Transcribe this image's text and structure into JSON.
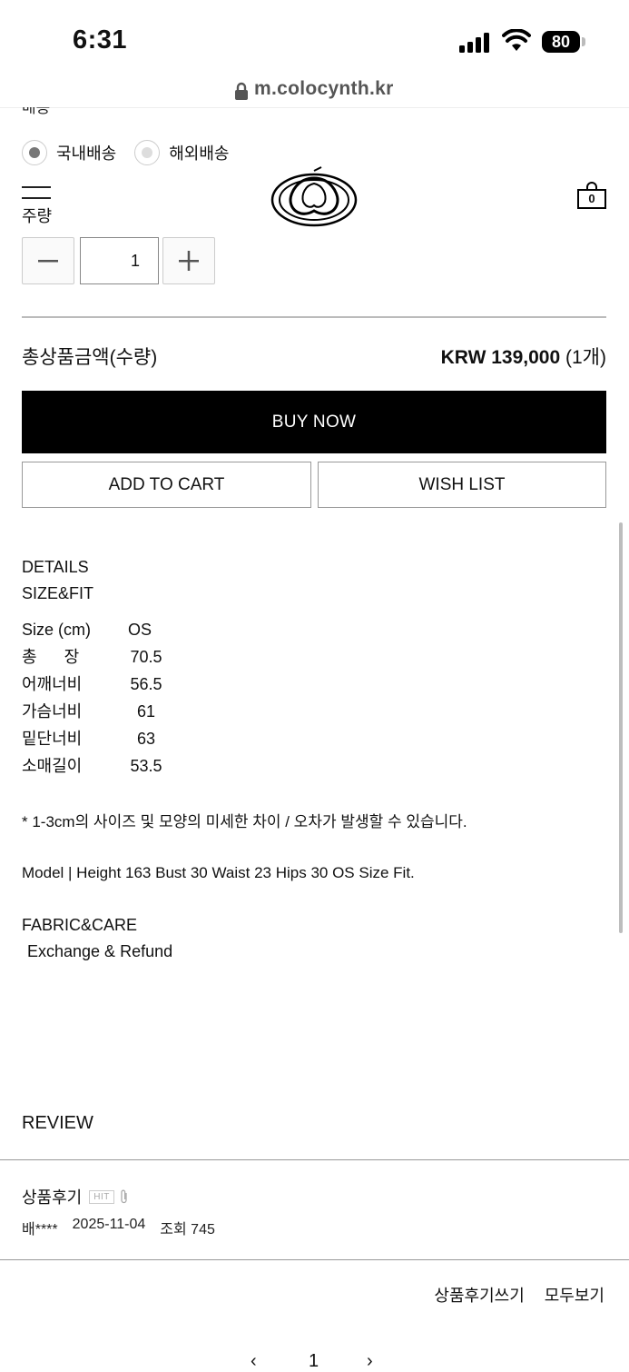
{
  "status": {
    "time": "6:31",
    "battery": "80"
  },
  "browser": {
    "url": "m.colocynth.kr"
  },
  "shipping": {
    "label": "배송",
    "options": [
      {
        "label": "국내배송",
        "selected": true
      },
      {
        "label": "해외배송",
        "selected": false
      }
    ]
  },
  "header": {
    "cart_count": "0"
  },
  "quantity": {
    "label": "주량",
    "value": "1"
  },
  "total": {
    "label": "총상품금액(수량)",
    "price": "KRW 139,000",
    "count": "(1개)"
  },
  "actions": {
    "buy_now": "BUY NOW",
    "add_to_cart": "ADD TO CART",
    "wish_list": "WISH LIST"
  },
  "details": {
    "title": "DETAILS",
    "size_fit": "SIZE&FIT",
    "size_rows": [
      {
        "label": "Size (cm)",
        "value": "OS"
      },
      {
        "label": "총      장",
        "value": "70.5"
      },
      {
        "label": "어깨너비",
        "value": "56.5"
      },
      {
        "label": "가슴너비",
        "value": "61"
      },
      {
        "label": "밑단너비",
        "value": "63"
      },
      {
        "label": "소매길이",
        "value": "53.5"
      }
    ],
    "note": "* 1-3cm의 사이즈 및 모양의 미세한 차이 / 오차가 발생할 수 있습니다.",
    "model": "Model | Height 163 Bust 30 Waist 23 Hips 30 OS Size Fit.",
    "fabric": "FABRIC&CARE",
    "exchange": "Exchange & Refund"
  },
  "review": {
    "title": "REVIEW",
    "post": {
      "title": "상품후기",
      "badge": "HIT",
      "author": "배****",
      "date": "2025-11-04",
      "views": "조회 745"
    },
    "write": "상품후기쓰기",
    "view_all": "모두보기"
  },
  "pagination": {
    "prev": "‹",
    "page": "1",
    "next": "›"
  }
}
